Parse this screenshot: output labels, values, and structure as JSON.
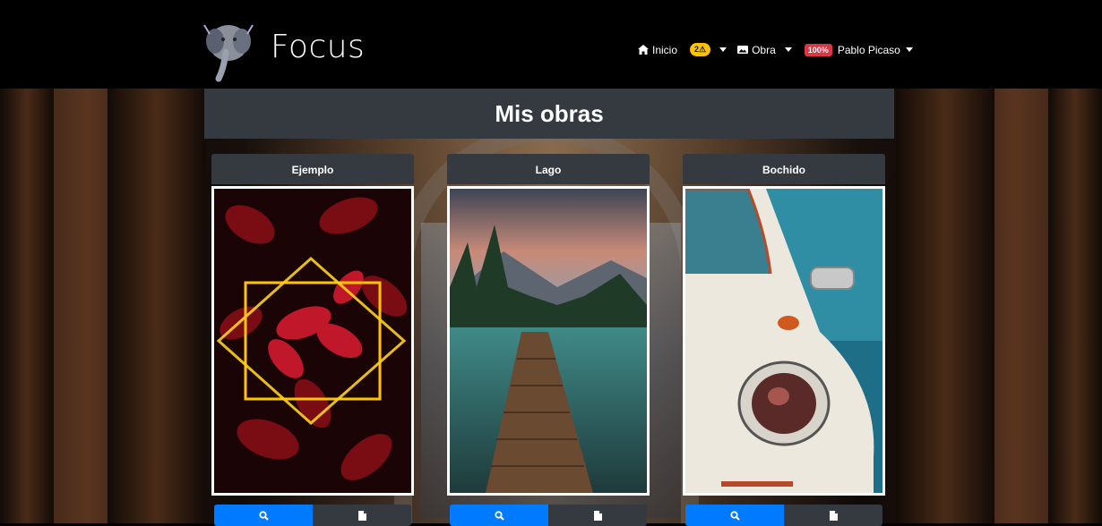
{
  "brand": {
    "name": "Focus",
    "logo_icon": "elephant-logo-icon"
  },
  "nav": {
    "home_label": "Inicio",
    "home_icon": "home-icon",
    "notifications_badge": "2⚠",
    "works_label": "Obra",
    "works_icon": "image-icon",
    "user_badge": "100%",
    "user_name": "Pablo Picaso"
  },
  "page": {
    "title": "Mis obras"
  },
  "works": [
    {
      "title": "Ejemplo",
      "image": "red-leaves-neon-square"
    },
    {
      "title": "Lago",
      "image": "lake-boardwalk"
    },
    {
      "title": "Bochido",
      "image": "vintage-white-car"
    }
  ],
  "actions": {
    "view_icon": "search-icon",
    "doc_icon": "document-icon"
  },
  "colors": {
    "primary": "#007bff",
    "dark": "#343a40",
    "warning": "#ffc107",
    "danger": "#dc3545"
  }
}
